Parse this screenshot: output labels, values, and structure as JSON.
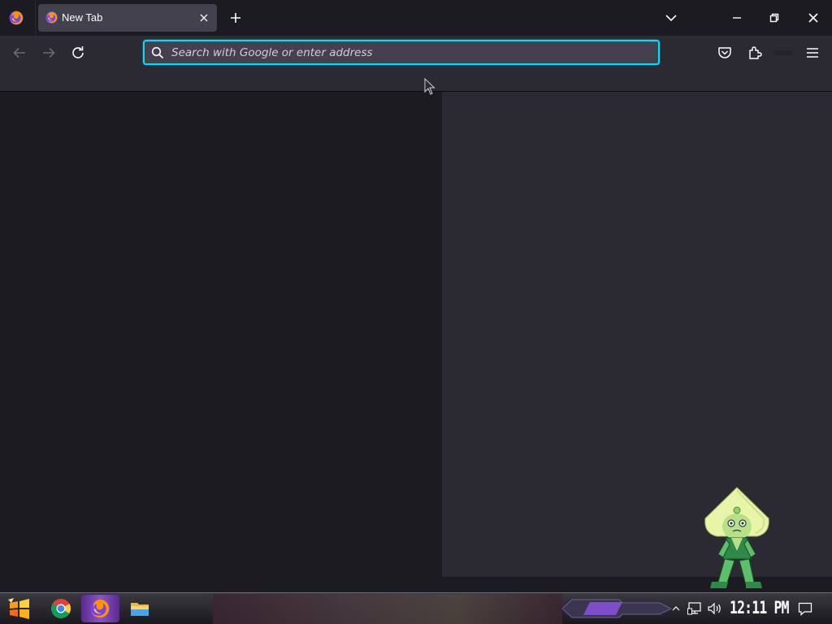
{
  "browser": {
    "tabs": [
      {
        "title": "New Tab",
        "active": true,
        "favicon": "firefox-icon"
      }
    ],
    "urlbar": {
      "placeholder": "Search with Google or enter address",
      "value": ""
    },
    "toolbar": {
      "icons": [
        "back-icon",
        "forward-icon",
        "reload-icon",
        "pocket-icon",
        "extensions-icon",
        "menu-icon"
      ]
    }
  },
  "taskbar": {
    "apps": [
      "start-icon",
      "chrome-icon",
      "firefox-icon",
      "file-explorer-icon"
    ],
    "clock": "12:11 PM"
  },
  "colors": {
    "accent": "#00ddff",
    "tab_bg": "#42414d",
    "toolbar_bg": "#2b2a33",
    "content_bg": "#1c1b22"
  }
}
